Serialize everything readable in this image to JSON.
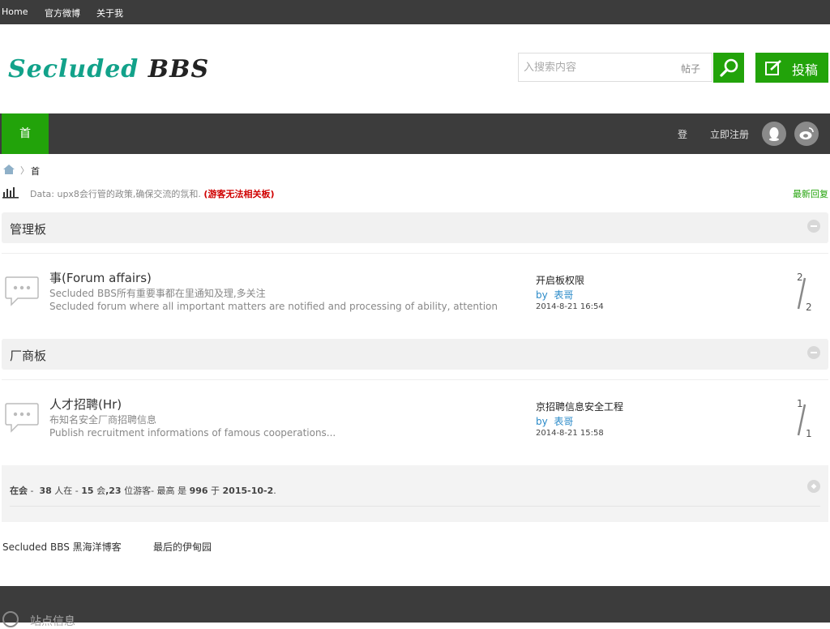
{
  "topbar": {
    "links": [
      "Home",
      "官方微博",
      "关于我"
    ]
  },
  "header": {
    "logo_part1": "Secluded",
    "logo_part2": "BBS",
    "search_placeholder": "入搜索内容",
    "search_scope": "帖子",
    "post_label": "投稿"
  },
  "nav": {
    "home": "首",
    "login": "登",
    "register": "立即注册",
    "social_icons": [
      "qq-icon",
      "weibo-icon"
    ]
  },
  "breadcrumb": {
    "current": "首"
  },
  "announcement": {
    "text": "Data: upx8会行管的政策,确保交流的氛和.",
    "warning": "(游客无法相关板)",
    "latest_label": "最新回复"
  },
  "sections": [
    {
      "title": "管理板",
      "forums": [
        {
          "title": "事(Forum affairs)",
          "desc_cn": "Secluded BBS所有重要事都在里通知及理,多关注",
          "desc_en": "Secluded forum where all important matters are notified and processing of ability, attention",
          "last_title": "开启板权限",
          "last_by": "by",
          "last_author": "表哥",
          "last_date": "2014-8-21 16:54",
          "threads": "2",
          "posts": "2"
        }
      ]
    },
    {
      "title": "厂商板",
      "forums": [
        {
          "title": "人才招聘(Hr)",
          "desc_cn": "布知名安全厂商招聘信息",
          "desc_en": "Publish recruitment informations of famous cooperations...",
          "last_title": "京招聘信息安全工程",
          "last_by": "by",
          "last_author": "表哥",
          "last_date": "2014-8-21 15:58",
          "threads": "1",
          "posts": "1"
        }
      ]
    }
  ],
  "online": {
    "label": "在会",
    "sep": "-",
    "total": "38",
    "t1": "人在",
    "t2": "-",
    "members": "15",
    "t3": "会",
    "guests": ",23",
    "t4": "位游客- 最高",
    "t5": "是",
    "max": "996",
    "t6": "于",
    "max_date": "2015-10-2",
    "t7": "."
  },
  "friend_links": [
    "Secluded BBS 黑海洋博客",
    "最后的伊甸园"
  ],
  "footer": {
    "title": "站点信息"
  },
  "colors": {
    "accent_green": "#22a30a",
    "logo_teal": "#12a28a",
    "dark_bar": "#3c3c3c",
    "warning_red": "#d00000",
    "link_blue": "#2a8ac8"
  }
}
